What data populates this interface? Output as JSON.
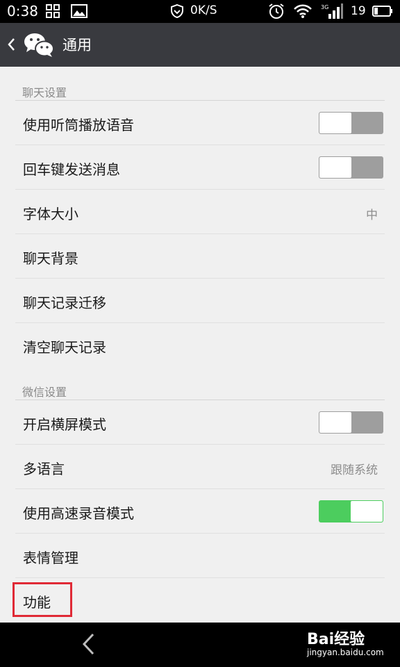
{
  "status_bar": {
    "time": "0:38",
    "net_speed": "0K/S",
    "battery_level": "19",
    "icons": [
      "grid-icon",
      "picture-icon",
      "shield-icon",
      "alarm-icon",
      "wifi-icon",
      "signal-3g-icon",
      "battery-icon"
    ]
  },
  "header": {
    "title": "通用",
    "icons": [
      "back-arrow-icon",
      "wechat-logo-icon"
    ]
  },
  "sections": [
    {
      "header": "聊天设置",
      "rows": [
        {
          "label": "使用听筒播放语音",
          "control": "toggle",
          "on": false
        },
        {
          "label": "回车键发送消息",
          "control": "toggle",
          "on": false
        },
        {
          "label": "字体大小",
          "control": "value",
          "value": "中"
        },
        {
          "label": "聊天背景",
          "control": "none"
        },
        {
          "label": "聊天记录迁移",
          "control": "none"
        },
        {
          "label": "清空聊天记录",
          "control": "none"
        }
      ]
    },
    {
      "header": "微信设置",
      "rows": [
        {
          "label": "开启横屏模式",
          "control": "toggle",
          "on": false
        },
        {
          "label": "多语言",
          "control": "value",
          "value": "跟随系统"
        },
        {
          "label": "使用高速录音模式",
          "control": "toggle",
          "on": true
        },
        {
          "label": "表情管理",
          "control": "none"
        },
        {
          "label": "功能",
          "control": "none",
          "highlighted": true
        }
      ]
    }
  ],
  "nav_bar": {
    "icons": [
      "nav-back-icon"
    ],
    "watermark": "Bai经验",
    "watermark_url": "jingyan.baidu.com"
  },
  "colors": {
    "title_bar": "#393a3f",
    "toggle_on": "#4ccd5e",
    "toggle_off": "#9e9e9e",
    "highlight": "#e02a36",
    "section_header": "#8a8a8a"
  }
}
